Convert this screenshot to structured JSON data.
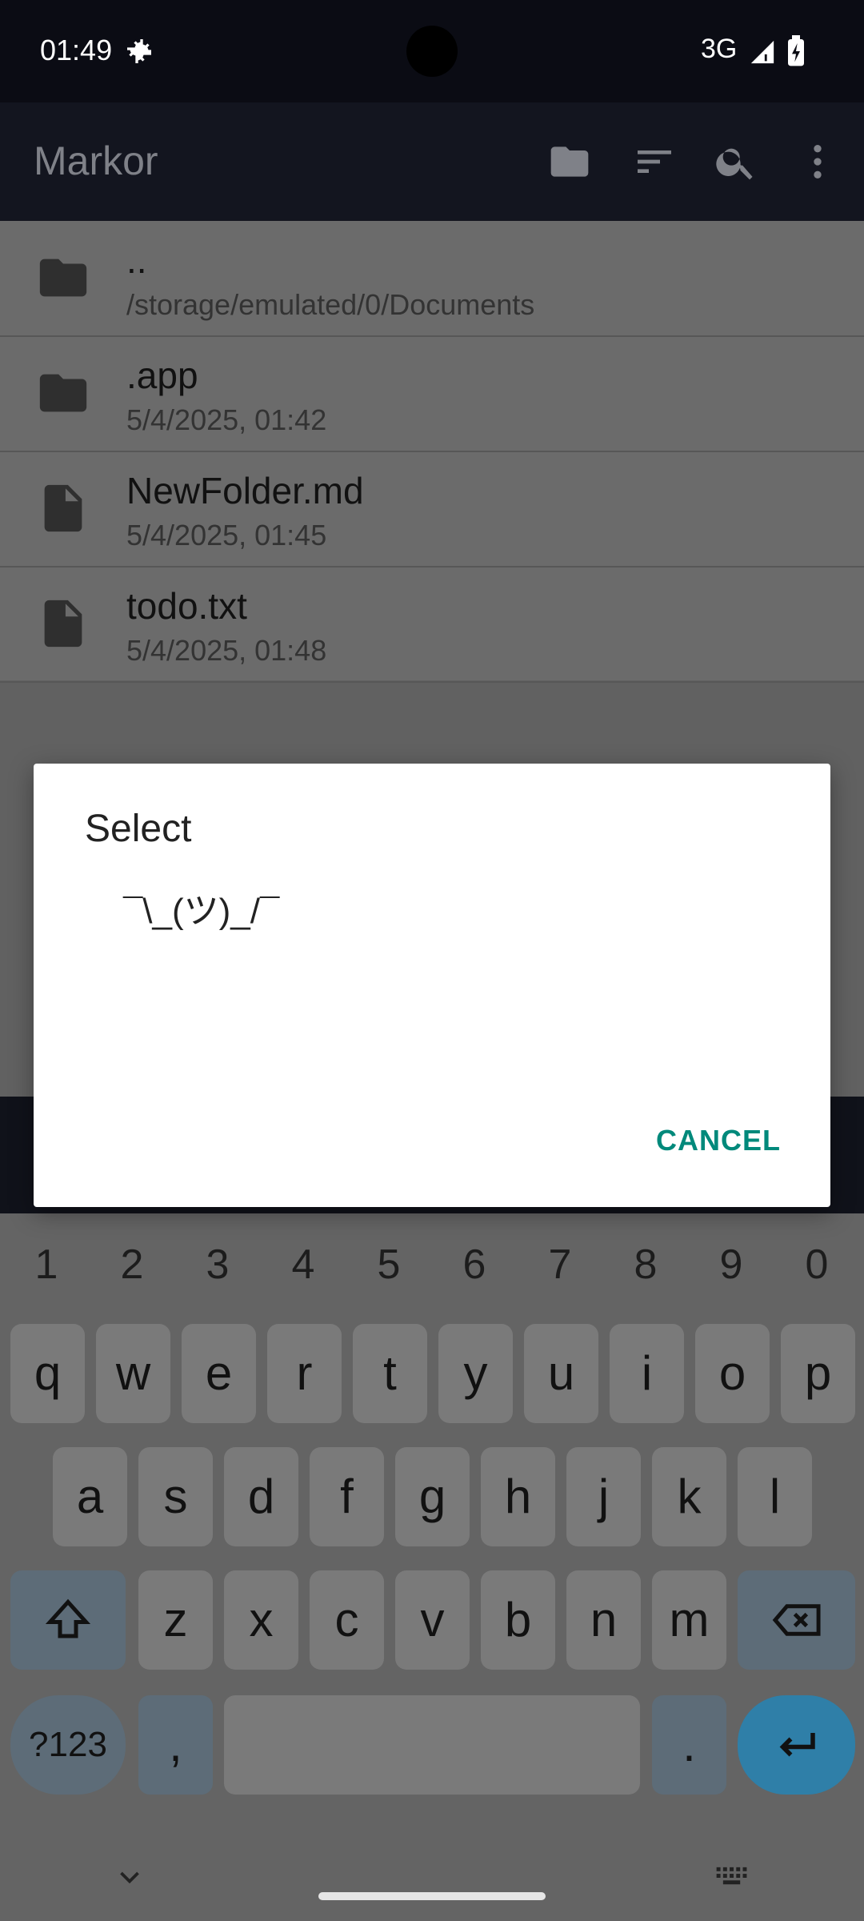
{
  "status_bar": {
    "time": "01:49",
    "network": "3G"
  },
  "app_bar": {
    "title": "Markor"
  },
  "files": [
    {
      "name": "..",
      "detail": "/storage/emulated/0/Documents",
      "type": "folder"
    },
    {
      "name": ".app",
      "detail": "5/4/2025, 01:42",
      "type": "folder"
    },
    {
      "name": "NewFolder.md",
      "detail": "5/4/2025, 01:45",
      "type": "file"
    },
    {
      "name": "todo.txt",
      "detail": "5/4/2025, 01:48",
      "type": "file"
    }
  ],
  "dialog": {
    "title": "Select",
    "item": "¯\\_(ツ)_/¯",
    "cancel_label": "CANCEL"
  },
  "keyboard": {
    "numbers": [
      "1",
      "2",
      "3",
      "4",
      "5",
      "6",
      "7",
      "8",
      "9",
      "0"
    ],
    "row1": [
      "q",
      "w",
      "e",
      "r",
      "t",
      "y",
      "u",
      "i",
      "o",
      "p"
    ],
    "row2": [
      "a",
      "s",
      "d",
      "f",
      "g",
      "h",
      "j",
      "k",
      "l"
    ],
    "row3": [
      "z",
      "x",
      "c",
      "v",
      "b",
      "n",
      "m"
    ],
    "symbols_label": "?123",
    "comma": ",",
    "period": "."
  },
  "colors": {
    "accent": "#00897b",
    "app_bar": "#13151f",
    "enter_key": "#2f7fa8"
  }
}
